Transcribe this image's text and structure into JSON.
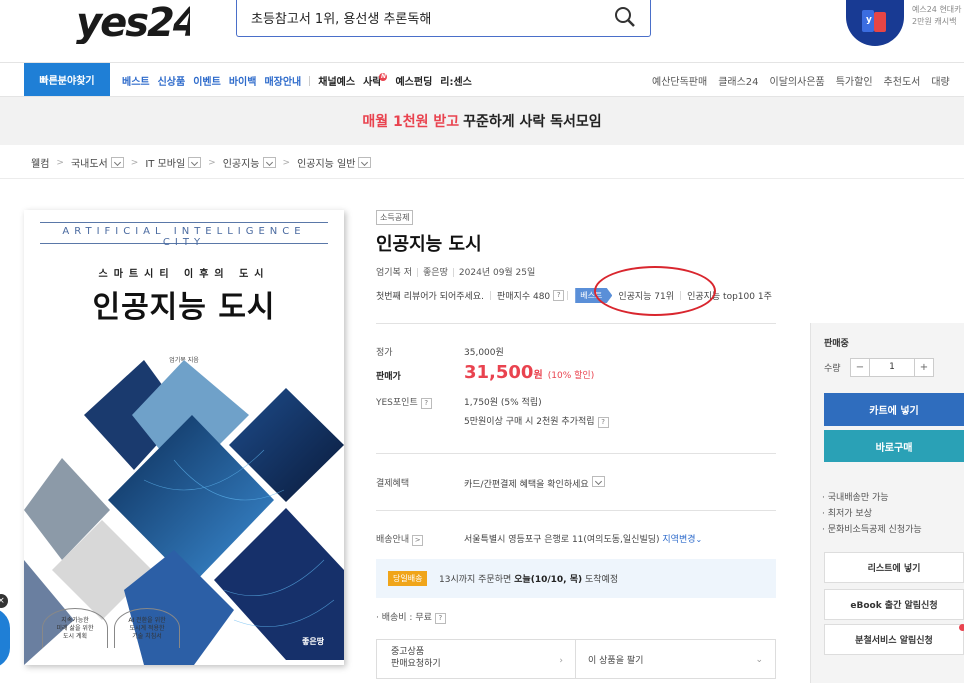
{
  "header": {
    "logo_text": "yes24",
    "search_query": "초등참고서 1위, 용선생 추론독해",
    "ad_text": [
      "예스24 현대카",
      "2만원 캐시백"
    ]
  },
  "nav": {
    "quick_button": "빠른분야찾기",
    "left_items_blue": [
      "베스트",
      "신상품",
      "이벤트",
      "바이백",
      "매장안내"
    ],
    "left_items_dark": [
      "채널예스",
      "사락",
      "예스펀딩",
      "리:센스"
    ],
    "right_items": [
      "예산단독판매",
      "클래스24",
      "이달의사은품",
      "특가할인",
      "추천도서",
      "대량"
    ]
  },
  "banner": {
    "highlight": "매월 1천원 받고",
    "rest": "꾸준하게 사락 독서모임"
  },
  "breadcrumb": [
    "웰컴",
    "국내도서",
    "IT 모바일",
    "인공지능",
    "인공지능 일반"
  ],
  "cover": {
    "en_title": "ARTIFICIAL INTELLIGENCE CITY",
    "subtitle": "스마트시티 이후의 도시",
    "title": "인공지능 도시",
    "author": "엄기복 지음",
    "badge1": [
      "지속가능한",
      "미래 삶을 위한",
      "도시 계획"
    ],
    "badge2": [
      "AI 전환을 위한",
      "도시계 적용한",
      "기술 치침서"
    ],
    "publisher": "좋은땅"
  },
  "product": {
    "tag": "소득공제",
    "title": "인공지능 도시",
    "author": "엄기복 저",
    "publisher": "좋은땅",
    "date": "2024년 09월 25일",
    "review_prompt": "첫번째 리뷰어가 되어주세요.",
    "sales_index": "판매지수 480",
    "best_tag": "베스트",
    "rank": "인공지능 71위",
    "top100": "인공지능 top100 1주"
  },
  "price": {
    "list_label": "정가",
    "list_value": "35,000원",
    "sale_label": "판매가",
    "sale_value": "31,500",
    "sale_unit": "원",
    "discount": "(10% 할인)",
    "points_label": "YES포인트",
    "points_value": "1,750원 (5% 적립)",
    "points_extra": "5만원이상 구매 시 2천원 추가적립"
  },
  "payment": {
    "label": "결제혜택",
    "value": "카드/간편결제 혜택을 확인하세요"
  },
  "shipping": {
    "label": "배송안내",
    "address": "서울특별시 영등포구 은행로 11(여의도동,일신빌딩)",
    "change": "지역변경",
    "same_day_tag": "당일배송",
    "eta_prefix": "13시까지 주문하면",
    "eta_bold": "오늘(10/10, 목)",
    "eta_suffix": "도착예정",
    "fee": "· 배송비 : 무료"
  },
  "used": {
    "left_line1": "중고상품",
    "left_line2": "판매요청하기",
    "right": "이 상품을 팔기"
  },
  "panel": {
    "status": "판매중",
    "qty_label": "수량",
    "qty": "1",
    "cart": "카트에 넣기",
    "buy": "바로구매",
    "notes": [
      "· 국내배송만 가능",
      "· 최저가 보상",
      "· 문화비소득공제 신청가능"
    ],
    "wishlist": "리스트에 넣기",
    "ebook": "eBook 출간 알림신청",
    "split": "분철서비스 알림신청"
  }
}
